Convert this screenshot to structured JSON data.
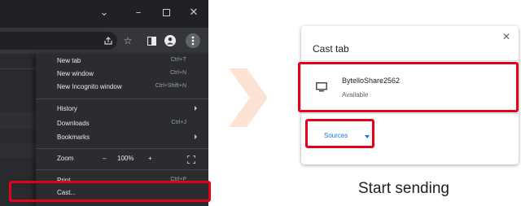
{
  "browser": {
    "window_controls": {
      "dropdown_icon": "chevron-down-icon",
      "minimize_icon": "minimize-icon",
      "maximize_icon": "maximize-icon",
      "close_icon": "close-icon"
    },
    "toolbar_icons": [
      "share-icon",
      "star-icon",
      "side-panel-icon",
      "profile-icon",
      "menu-icon"
    ],
    "menu": {
      "items": [
        {
          "label": "New tab",
          "shortcut": "Ctrl+T"
        },
        {
          "label": "New window",
          "shortcut": "Ctrl+N"
        },
        {
          "label": "New Incognito window",
          "shortcut": "Ctrl+Shift+N"
        },
        {
          "label": "History",
          "shortcut": ""
        },
        {
          "label": "Downloads",
          "shortcut": "Ctrl+J"
        },
        {
          "label": "Bookmarks",
          "shortcut": ""
        },
        {
          "label": "Zoom",
          "shortcut": ""
        },
        {
          "label": "Print...",
          "shortcut": "Ctrl+P"
        },
        {
          "label": "Cast...",
          "shortcut": ""
        }
      ],
      "zoom": {
        "minus": "–",
        "value": "100%",
        "plus": "+"
      }
    }
  },
  "cast_dialog": {
    "title": "Cast tab",
    "close_symbol": "✕",
    "device": {
      "name": "BytelloShare2562",
      "status": "Available",
      "icon": "monitor-icon"
    },
    "sources_label": "Sources"
  },
  "caption": "Start sending",
  "colors": {
    "highlight": "#e6001a",
    "accent": "#1a73e8",
    "menu_bg": "#2b2c2f",
    "arrow": "#fde3d3"
  }
}
